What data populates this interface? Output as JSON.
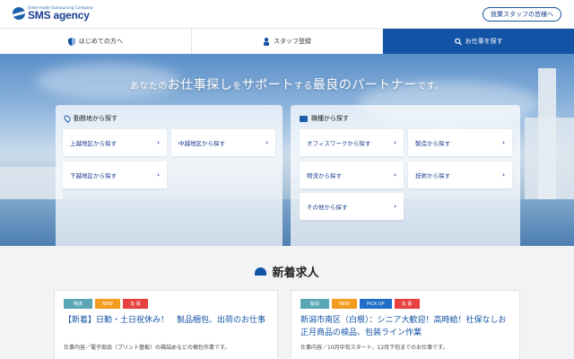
{
  "header": {
    "logo_tagline": "Order-made Outsourcing Company",
    "logo_name": "SMS agency",
    "staff_button": "就業スタッフの皆様へ"
  },
  "nav": {
    "tabs": [
      {
        "label": "はじめての方へ",
        "icon": "shield-icon"
      },
      {
        "label": "スタッフ登録",
        "icon": "person-icon"
      },
      {
        "label": "お仕事を探す",
        "icon": "search-icon",
        "active": true
      }
    ]
  },
  "hero": {
    "tagline_a": "あなたの",
    "tagline_b": "お仕事探し",
    "tagline_c": "を",
    "tagline_d": "サポート",
    "tagline_e": "する",
    "tagline_f": "最良のパートナー",
    "tagline_g": "です。",
    "area_panel": {
      "title": "勤務地から探す",
      "icon": "map-pin-icon",
      "buttons": [
        "上越地区から探す",
        "中越地区から探す",
        "下越地区から探す"
      ]
    },
    "job_panel": {
      "title": "職種から探す",
      "icon": "briefcase-icon",
      "buttons": [
        "オフィスワークから探す",
        "製造から探す",
        "物流から探す",
        "技術から探す",
        "その他から探す"
      ]
    }
  },
  "new_jobs": {
    "title": "新着求人",
    "icon": "cap-icon",
    "cards": [
      {
        "tags": [
          "物流",
          "NEW",
          "急 募"
        ],
        "title": "【新着】日勤・土日祝休み！　製品梱包、出荷のお仕事",
        "desc": "仕事内容／電子部品（プリント基板）の箱詰めなどの梱包作業です。",
        "desc2": "　"
      },
      {
        "tags": [
          "製造",
          "NEW",
          "PICK UP",
          "急 募"
        ],
        "title": "新潟市南区（白根）：シニア大歓迎！高時給！社保なしお正月商品の検品、包装ライン作業",
        "desc": "仕事内容／10月中旬スタート、12月下旬までのお仕事です。",
        "desc2": "　"
      }
    ]
  },
  "colors": {
    "brand": "#1353a5",
    "tag_logistics": "#5aa6b5",
    "tag_new": "#f39c1f",
    "tag_urgent": "#e8403e",
    "tag_pickup": "#1f6fc6"
  }
}
